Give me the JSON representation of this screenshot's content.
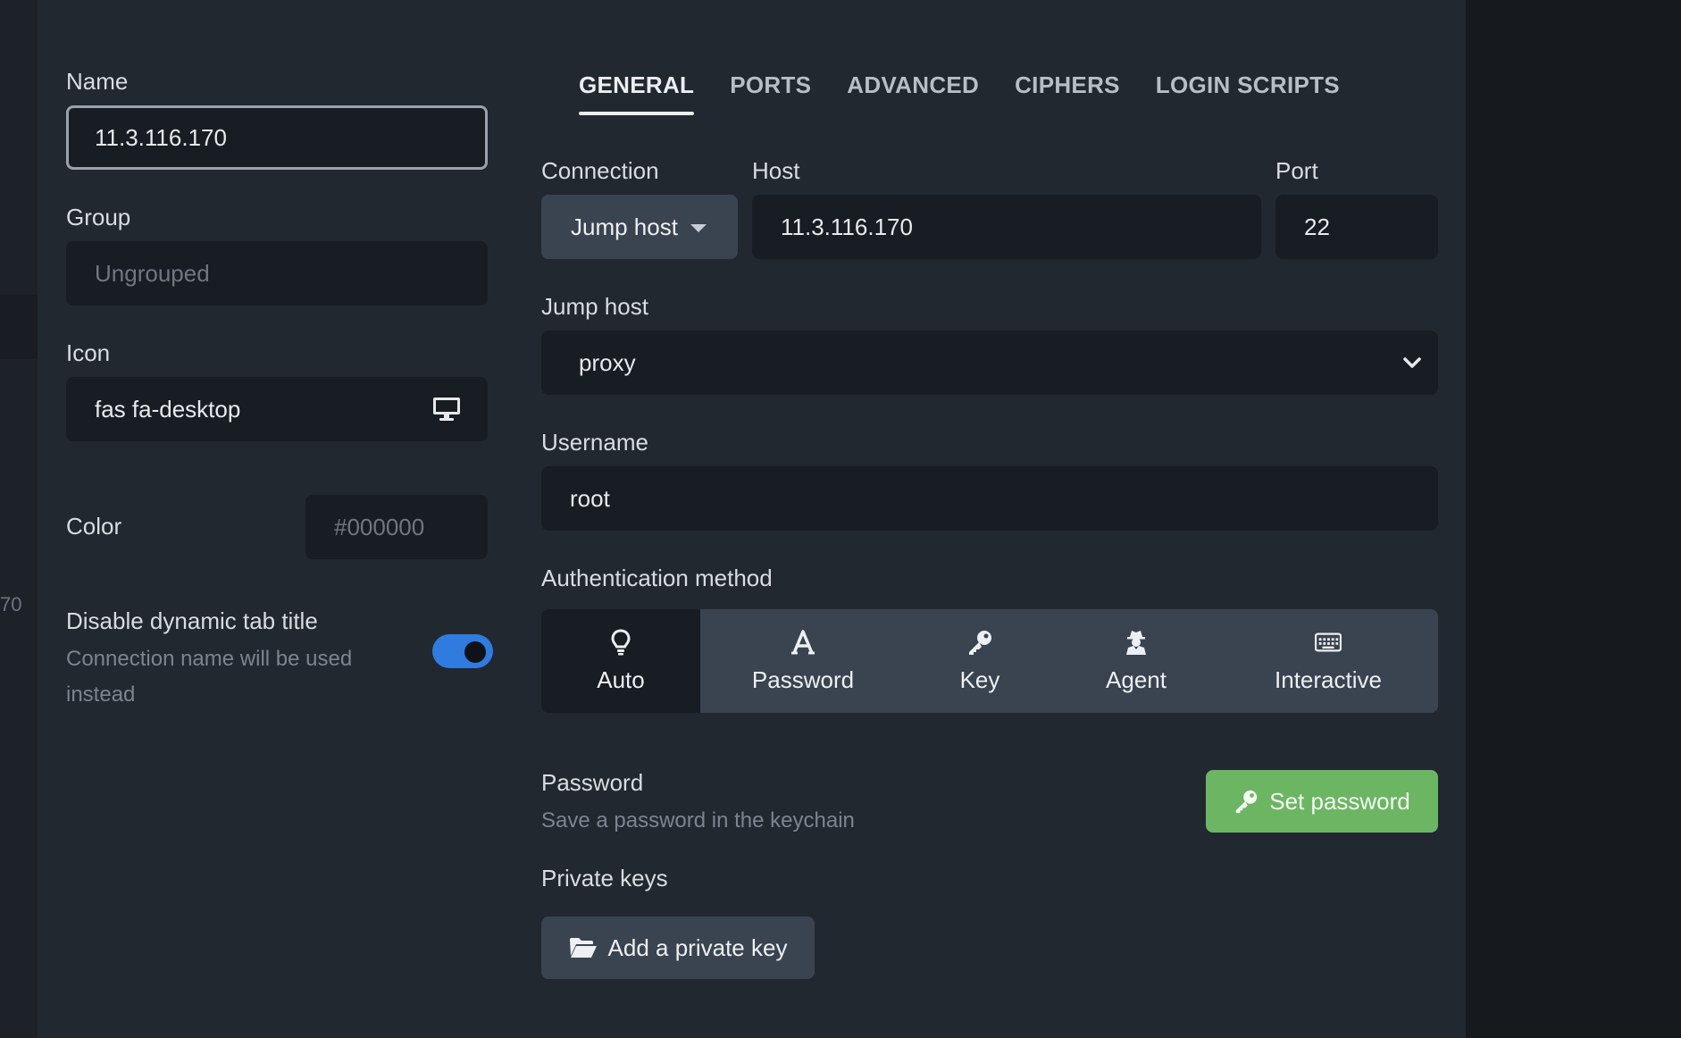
{
  "background": {
    "fragment_text": "70"
  },
  "left": {
    "name": {
      "label": "Name",
      "value": "11.3.116.170"
    },
    "group": {
      "label": "Group",
      "placeholder": "Ungrouped"
    },
    "icon": {
      "label": "Icon",
      "value": "fas fa-desktop",
      "icon_name": "desktop-icon"
    },
    "color": {
      "label": "Color",
      "placeholder": "#000000"
    },
    "dynamic_title": {
      "label": "Disable dynamic tab title",
      "help_line1": "Connection name will be used",
      "help_line2": "instead",
      "enabled": true
    }
  },
  "tabs": [
    {
      "label": "GENERAL",
      "active": true
    },
    {
      "label": "PORTS",
      "active": false
    },
    {
      "label": "ADVANCED",
      "active": false
    },
    {
      "label": "CIPHERS",
      "active": false
    },
    {
      "label": "LOGIN SCRIPTS",
      "active": false
    }
  ],
  "general": {
    "connection": {
      "label": "Connection",
      "value": "Jump host"
    },
    "host": {
      "label": "Host",
      "value": "11.3.116.170"
    },
    "port": {
      "label": "Port",
      "value": "22"
    },
    "jump_host": {
      "label": "Jump host",
      "value": "proxy"
    },
    "username": {
      "label": "Username",
      "value": "root"
    },
    "auth": {
      "label": "Authentication method",
      "options": [
        {
          "label": "Auto",
          "icon": "lightbulb-icon",
          "active": true
        },
        {
          "label": "Password",
          "icon": "font-a-icon",
          "active": false
        },
        {
          "label": "Key",
          "icon": "key-icon",
          "active": false
        },
        {
          "label": "Agent",
          "icon": "user-secret-icon",
          "active": false
        },
        {
          "label": "Interactive",
          "icon": "keyboard-icon",
          "active": false
        }
      ]
    },
    "password": {
      "label": "Password",
      "help": "Save a password in the keychain",
      "button": "Set password"
    },
    "private_keys": {
      "label": "Private keys",
      "button": "Add a private key"
    }
  },
  "colors": {
    "accent_green": "#6cb663",
    "toggle_blue": "#2f7be0",
    "panel": "#212830",
    "input": "#181d23"
  }
}
